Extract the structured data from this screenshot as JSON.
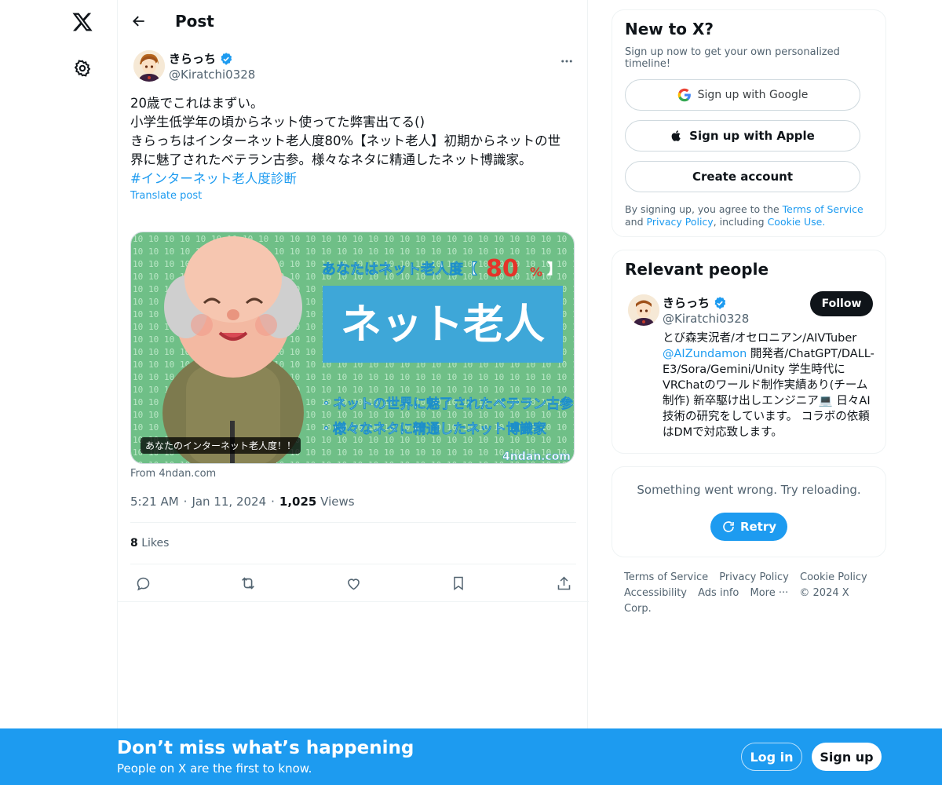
{
  "nav": {
    "logo_icon": "x-logo-icon",
    "settings_icon": "gear-icon"
  },
  "header": {
    "back_icon": "arrow-left-icon",
    "title": "Post"
  },
  "post": {
    "author_name": "きらっち",
    "author_handle": "@Kiratchi0328",
    "verified": true,
    "text_lines": [
      "20歳でこれはまずい。",
      "小学生低学年の頃からネット使ってた弊害出てる()",
      "",
      "きらっちはインターネット老人度80%【ネット老人】初期からネットの世",
      "界に魅了されたベテラン古参。様々なネタに精通したネット博識家。"
    ],
    "hashtag": "#インターネット老人度診断",
    "translate": "Translate post",
    "media": {
      "caption": "あなたのインターネット老人度！！",
      "heading": "あなたはネット老人度【",
      "percent": "80",
      "percent_sign": "%",
      "heading_close": "】",
      "title": "ネット老人",
      "bullet1": "・ネットの世界に魅了されたベテラン古参",
      "bullet2": "・様々なネタに精通したネット博識家",
      "watermark": "4ndan.com"
    },
    "from_source": "From 4ndan.com",
    "time": "5:21 AM",
    "date": "Jan 11, 2024",
    "views_count": "1,025",
    "views_label": "Views",
    "likes_count": "8",
    "likes_label": "Likes"
  },
  "actions": [
    "reply-icon",
    "repost-icon",
    "like-icon",
    "bookmark-icon",
    "share-icon"
  ],
  "new_to_x": {
    "title": "New to X?",
    "subtitle": "Sign up now to get your own personalized timeline!",
    "google": "Sign up with Google",
    "apple": "Sign up with Apple",
    "create": "Create account",
    "legal_prefix": "By signing up, you agree to the ",
    "tos": "Terms of Service",
    "and": " and",
    "privacy": "Privacy Policy",
    "including": ", including ",
    "cookie": "Cookie Use."
  },
  "relevant": {
    "title": "Relevant people",
    "name": "きらっち",
    "handle": "@Kiratchi0328",
    "follow": "Follow",
    "bio_prefix": "とび森実況者/オセロニアン/AIVTuber ",
    "bio_mention": "@AIZundamon",
    "bio_suffix": " 開発者/ChatGPT/DALL-E3/Sora/Gemini/Unity 学生時代にVRChatのワールド制作実績あり(チーム制作) 新卒駆け出しエンジニア💻 日々AI技術の研究をしています。 コラボの依頼はDMで対応致します。"
  },
  "error": {
    "text": "Something went wrong. Try reloading.",
    "retry": "Retry"
  },
  "footer": {
    "links_row1": [
      "Terms of Service",
      "Privacy Policy",
      "Cookie Policy"
    ],
    "links_row2": [
      "Accessibility",
      "Ads info",
      "More ···",
      "© 2024 X Corp."
    ]
  },
  "bottom_bar": {
    "title": "Don’t miss what’s happening",
    "subtitle": "People on X are the first to know.",
    "login": "Log in",
    "signup": "Sign up"
  },
  "colors": {
    "accent": "#1d9bf0",
    "text": "#0f1419",
    "muted": "#536471"
  }
}
